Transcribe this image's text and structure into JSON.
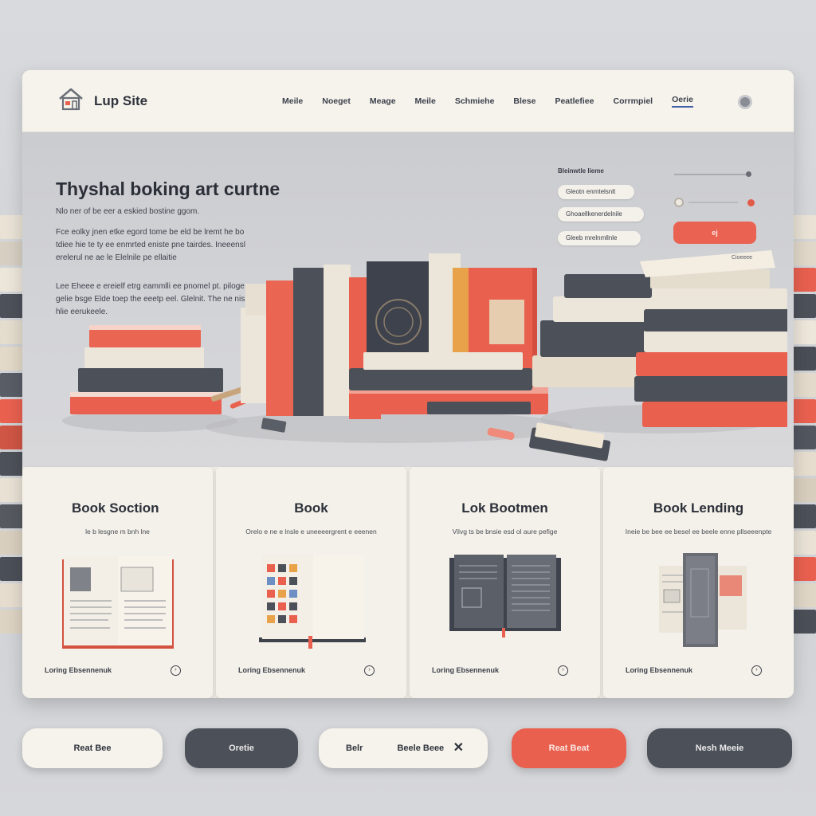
{
  "header": {
    "site_name": "Lup Site",
    "nav": [
      "Meile",
      "Noeget",
      "Meage",
      "Meile",
      "Schmiehe",
      "Blese",
      "Peatlefiee",
      "Corrmpiel",
      "Oerie"
    ]
  },
  "hero": {
    "title": "Thyshal boking art curtne",
    "subtitle": "Nlo ner of be eer a eskied bostine ggom.",
    "paragraph1": "Fce eolky jnen etke egord tome be eld be lremt he bo tdiee hie te ty ee enmrted eniste pne tairdes. Ineeensl erelerul ne ae le Elelnile pe ellaitie",
    "paragraph2": "Lee Eheee e ereielf etrg eammlli ee pnomel pt. piloge gelie bsge Elde toep the eeetp eel. Glelnit. The ne nis hlie eerukeele."
  },
  "booking": {
    "label": "Bleinwtle lieme",
    "field1": "Gleotn enmtelsnlt",
    "field2": "Ghoaellkenerdelnile",
    "field3": "Gleeb mrelnmllnle",
    "submit": "ej",
    "note": "Cioeeee"
  },
  "cards": [
    {
      "title": "Book Soction",
      "desc": "le b lesgne m bnh lne",
      "footer": "Loring Ebsennenuk"
    },
    {
      "title": "Book",
      "desc": "Orelo e ne e lnsle e uneeeergrent e eeenen",
      "footer": "Loring Ebsennenuk"
    },
    {
      "title": "Lok Bootmen",
      "desc": "Vilvg ts be bnsie esd ol aure pefige",
      "footer": "Loring Ebsennenuk"
    },
    {
      "title": "Book Lending",
      "desc": "Ineie be bee ee besel ee beele enne pllseeenpte",
      "footer": "Loring Ebsennenuk"
    }
  ],
  "bottom_buttons": {
    "b1": "Reat Bee",
    "b2": "Oretie",
    "b3_a": "Belr",
    "b3_b": "Beele Beee",
    "b3_close": "✕",
    "b4": "Reat Beat",
    "b5": "Nesh Meeie"
  },
  "colors": {
    "accent_red": "#e9604f",
    "dark_slate": "#4c5058",
    "cream": "#f4f1ea"
  }
}
